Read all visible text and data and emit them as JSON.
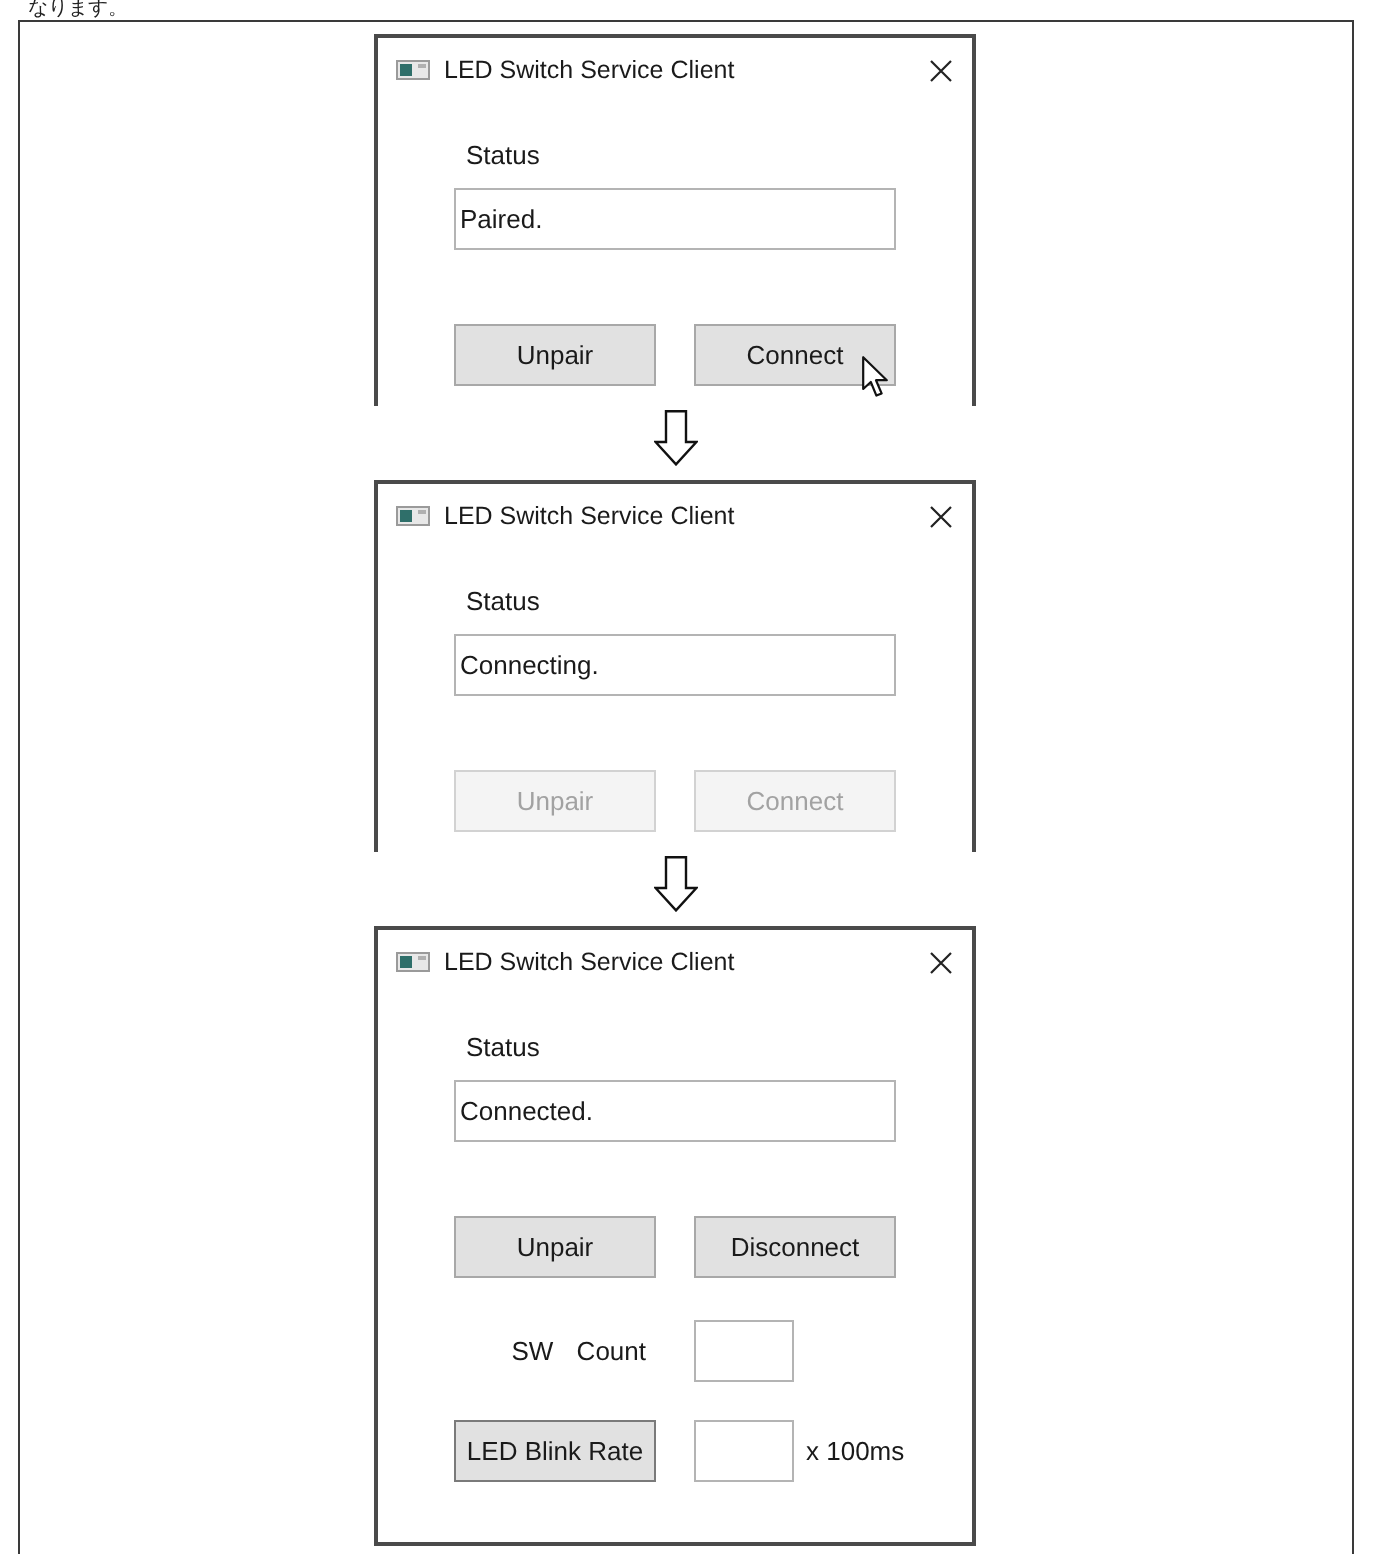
{
  "caption": "なります。",
  "screens": [
    {
      "title": "LED Switch Service Client",
      "status_label": "Status",
      "status": "Paired.",
      "buttons": [
        {
          "label": "Unpair",
          "disabled": false,
          "hovered": false
        },
        {
          "label": "Connect",
          "disabled": false,
          "hovered": true
        }
      ]
    },
    {
      "title": "LED Switch Service Client",
      "status_label": "Status",
      "status": "Connecting.",
      "buttons": [
        {
          "label": "Unpair",
          "disabled": true,
          "hovered": false
        },
        {
          "label": "Connect",
          "disabled": true,
          "hovered": false
        }
      ]
    },
    {
      "title": "LED Switch Service Client",
      "status_label": "Status",
      "status": "Connected.",
      "buttons": [
        {
          "label": "Unpair",
          "disabled": false,
          "hovered": false
        },
        {
          "label": "Disconnect",
          "disabled": false,
          "hovered": false
        }
      ],
      "sw_count": {
        "label": "SW Count"
      },
      "blink_rate": {
        "button": "LED Blink Rate",
        "unit": "x 100ms"
      }
    }
  ]
}
